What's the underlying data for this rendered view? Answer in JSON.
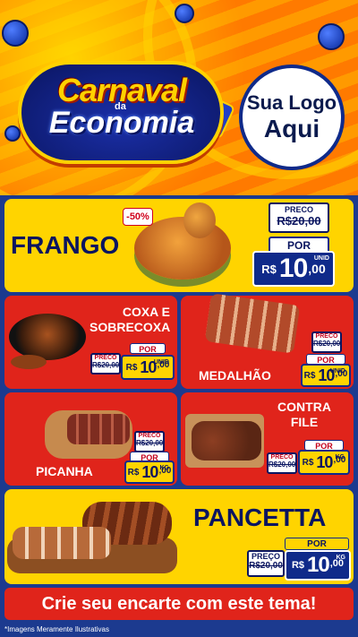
{
  "hero": {
    "title_line1": "Carnaval",
    "title_da": "da",
    "title_line2": "Economia",
    "logo_line1": "Sua Logo",
    "logo_line2": "Aqui"
  },
  "colors": {
    "brand_blue": "#0f2a8a",
    "brand_yellow": "#ffd400",
    "brand_red": "#e0241b"
  },
  "products": {
    "frango": {
      "name": "FRANGO",
      "discount": "-50%",
      "preco_label": "PRECO",
      "old_price": "R$20,00",
      "por_label": "POR",
      "currency": "R$",
      "price_int": "10",
      "price_dec": ",00",
      "unit": "UNID"
    },
    "coxa": {
      "name_line1": "COXA E",
      "name_line2": "SOBRECOXA",
      "preco_label": "PRECO",
      "old_price": "R$20,00",
      "por_label": "POR",
      "currency": "R$",
      "price_int": "10",
      "price_dec": ",00",
      "unit": "UNID"
    },
    "medalhao": {
      "name": "MEDALHÃO",
      "preco_label": "PRECO",
      "old_price": "R$20,00",
      "por_label": "POR",
      "currency": "R$",
      "price_int": "10",
      "price_dec": ",00",
      "unit": "UNID"
    },
    "picanha": {
      "name": "PICANHA",
      "preco_label": "PRECO",
      "old_price": "R$20,00",
      "por_label": "POR",
      "currency": "R$",
      "price_int": "10",
      "price_dec": ",00",
      "unit": "KG"
    },
    "contra_file": {
      "name_line1": "CONTRA",
      "name_line2": "FILE",
      "preco_label": "PRECO",
      "old_price": "R$20,00",
      "por_label": "POR",
      "currency": "R$",
      "price_int": "10",
      "price_dec": ",00",
      "unit": "KG"
    },
    "pancetta": {
      "name": "PANCETTA",
      "preco_label": "PREÇO",
      "old_price": "R$20,00",
      "por_label": "POR",
      "currency": "R$",
      "price_int": "10",
      "price_dec": ",00",
      "unit": "KG"
    }
  },
  "cta": "Crie seu encarte com este tema!",
  "footnote": "*Imagens Meramente Ilustrativas"
}
